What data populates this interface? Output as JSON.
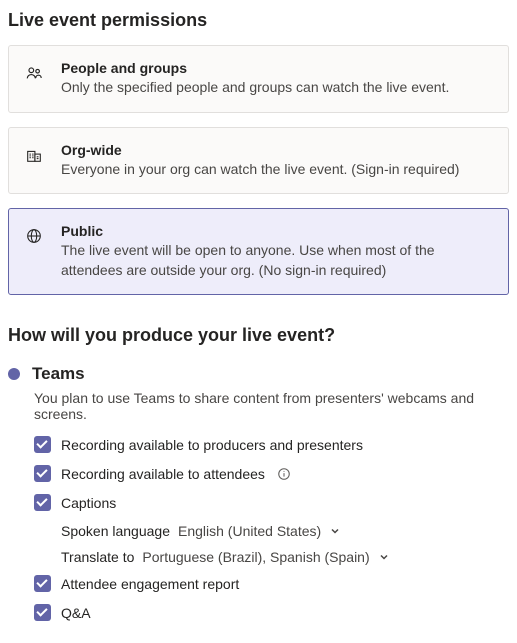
{
  "permissions": {
    "heading": "Live event permissions",
    "options": [
      {
        "title": "People and groups",
        "desc": "Only the specified people and groups can watch the live event."
      },
      {
        "title": "Org-wide",
        "desc": "Everyone in your org can watch the live event. (Sign-in required)"
      },
      {
        "title": "Public",
        "desc": "The live event will be open to anyone. Use when most of the attendees are outside your org. (No sign-in required)"
      }
    ]
  },
  "produce": {
    "heading": "How will you produce your live event?",
    "option_label": "Teams",
    "option_desc": "You plan to use Teams to share content from presenters' webcams and screens.",
    "checks": {
      "recording_producers": "Recording available to producers and presenters",
      "recording_attendees": "Recording available to attendees",
      "captions": "Captions",
      "engagement": "Attendee engagement report",
      "qa": "Q&A"
    },
    "spoken_label": "Spoken language",
    "spoken_value": "English (United States)",
    "translate_label": "Translate to",
    "translate_value": "Portuguese (Brazil), Spanish (Spain)"
  }
}
